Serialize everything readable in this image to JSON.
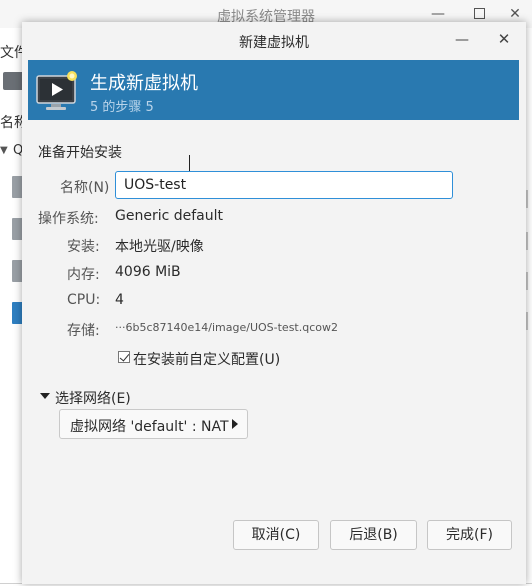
{
  "main_window": {
    "title": "虚拟系统管理器",
    "menu_label": "文件",
    "column_label": "名称",
    "group_label": "Q"
  },
  "dialog": {
    "title": "新建虚拟机",
    "header": {
      "title": "生成新虚拟机",
      "step": "5 的步骤 5"
    },
    "section_title": "准备开始安装",
    "name": {
      "label": "名称(N)",
      "value": "UOS-test"
    },
    "details": {
      "os_label": "操作系统:",
      "os_value": "Generic default",
      "install_label": "安装:",
      "install_value": "本地光驱/映像",
      "memory_label": "内存:",
      "memory_value": "4096 MiB",
      "cpu_label": "CPU:",
      "cpu_value": "4",
      "storage_label": "存储:",
      "storage_value": "···6b5c87140e14/image/UOS-test.qcow2"
    },
    "customize_checkbox": {
      "label": "在安装前自定义配置(U)",
      "checked": true
    },
    "network": {
      "expander_label": "选择网络(E)",
      "selected": "虚拟网络 'default' : NAT"
    },
    "buttons": {
      "cancel": "取消(C)",
      "back": "后退(B)",
      "finish": "完成(F)"
    }
  },
  "colors": {
    "banner": "#2979b0",
    "focus": "#2f8fd8"
  }
}
